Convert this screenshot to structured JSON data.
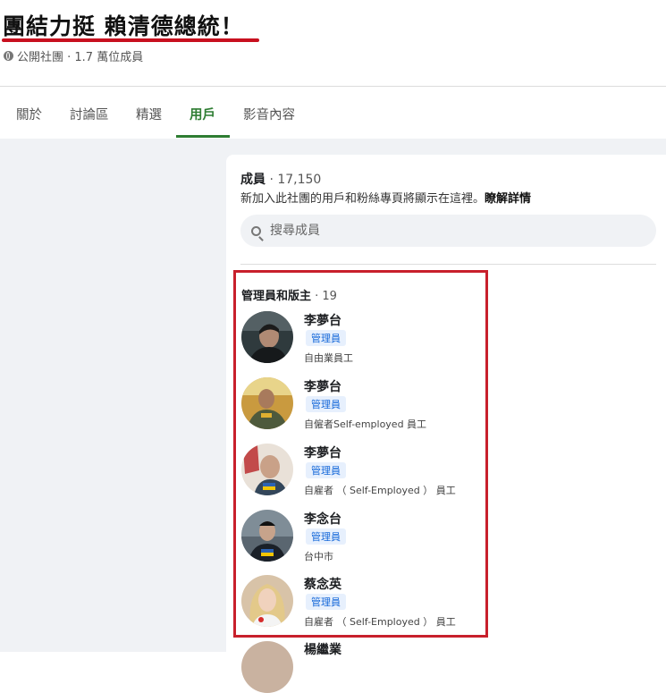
{
  "group": {
    "title": "團結力挺 賴清德總統！",
    "meta": "公開社團 · 1.7 萬位成員"
  },
  "tabs": [
    {
      "label": "關於"
    },
    {
      "label": "討論區"
    },
    {
      "label": "精選"
    },
    {
      "label": "用戶",
      "active": true
    },
    {
      "label": "影音內容"
    }
  ],
  "members": {
    "label": "成員",
    "count": " · 17,150",
    "desc": "新加入此社團的用戶和粉絲專頁將顯示在這裡。",
    "learn_more": "瞭解詳情",
    "search_placeholder": "搜尋成員"
  },
  "admins": {
    "label": "管理員和版主",
    "count": " · 19",
    "list": [
      {
        "name": "李夢台",
        "role": "管理員",
        "work": "自由業員工"
      },
      {
        "name": "李夢台",
        "role": "管理員",
        "work": "自僱者Self-employed 員工"
      },
      {
        "name": "李夢台",
        "role": "管理員",
        "work": "自雇者 （ Self-Employed ） 員工"
      },
      {
        "name": "李念台",
        "role": "管理員",
        "work": "台中市"
      },
      {
        "name": "蔡念英",
        "role": "管理員",
        "work": "自雇者 （ Self-Employed ） 員工"
      }
    ],
    "partial_name": "楊繼業"
  },
  "colors": {
    "accent": "#2e7d32",
    "highlight": "#c8202c",
    "badge": "#1467d9"
  }
}
